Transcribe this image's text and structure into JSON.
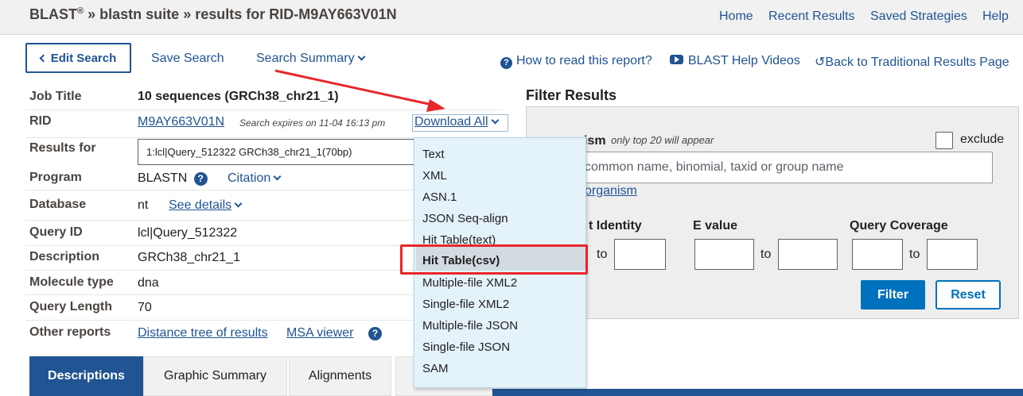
{
  "header": {
    "brand": "BLAST",
    "reg": "®",
    "sep1": "»",
    "suite": "blastn suite",
    "sep2": "»",
    "results": "results for RID-M9AY663V01N",
    "nav": [
      "Home",
      "Recent Results",
      "Saved Strategies",
      "Help"
    ]
  },
  "toolbar": {
    "edit_search": "Edit Search",
    "save_search": "Save Search",
    "search_summary": "Search Summary",
    "how_to_read": "How to read this report?",
    "help_videos": "BLAST Help Videos",
    "back_traditional": "Back to Traditional Results Page"
  },
  "job": {
    "job_title_label": "Job Title",
    "job_title_value": "10 sequences (GRCh38_chr21_1)",
    "rid_label": "RID",
    "rid_value": "M9AY663V01N",
    "rid_expires": "Search expires on 11-04 16:13 pm",
    "download_all": "Download All",
    "results_for_label": "Results for",
    "results_for_value": "1:lcl|Query_512322 GRCh38_chr21_1(70bp)",
    "program_label": "Program",
    "program_value": "BLASTN",
    "citation": "Citation",
    "database_label": "Database",
    "database_value": "nt",
    "see_details": "See details",
    "query_id_label": "Query ID",
    "query_id_value": "lcl|Query_512322",
    "description_label": "Description",
    "description_value": "GRCh38_chr21_1",
    "molecule_label": "Molecule type",
    "molecule_value": "dna",
    "query_length_label": "Query Length",
    "query_length_value": "70",
    "other_reports_label": "Other reports",
    "distance_tree": "Distance tree of results",
    "msa_viewer": "MSA viewer"
  },
  "download_menu": {
    "items": [
      "Text",
      "XML",
      "ASN.1",
      "JSON Seq-align",
      "Hit Table(text)",
      "Hit Table(csv)",
      "Multiple-file XML2",
      "Single-file XML2",
      "Multiple-file JSON",
      "Single-file JSON",
      "SAM"
    ],
    "highlighted": "Hit Table(csv)"
  },
  "filter": {
    "title": "Filter Results",
    "organism_label_visible": "ism",
    "organism_hint": "only top 20 will appear",
    "exclude": "exclude",
    "organism_placeholder": "common name, binomial, taxid or group name",
    "add_organism_visible": "organism",
    "percent_identity_visible": "t Identity",
    "e_value": "E value",
    "query_coverage": "Query Coverage",
    "to": "to",
    "filter_button": "Filter",
    "reset_button": "Reset"
  },
  "tabs": [
    "Descriptions",
    "Graphic Summary",
    "Alignments"
  ],
  "colors": {
    "link": "#205493",
    "primary_button": "#0071bc",
    "annotation_red": "#e8262a",
    "menu_bg": "#e4f2fa"
  }
}
